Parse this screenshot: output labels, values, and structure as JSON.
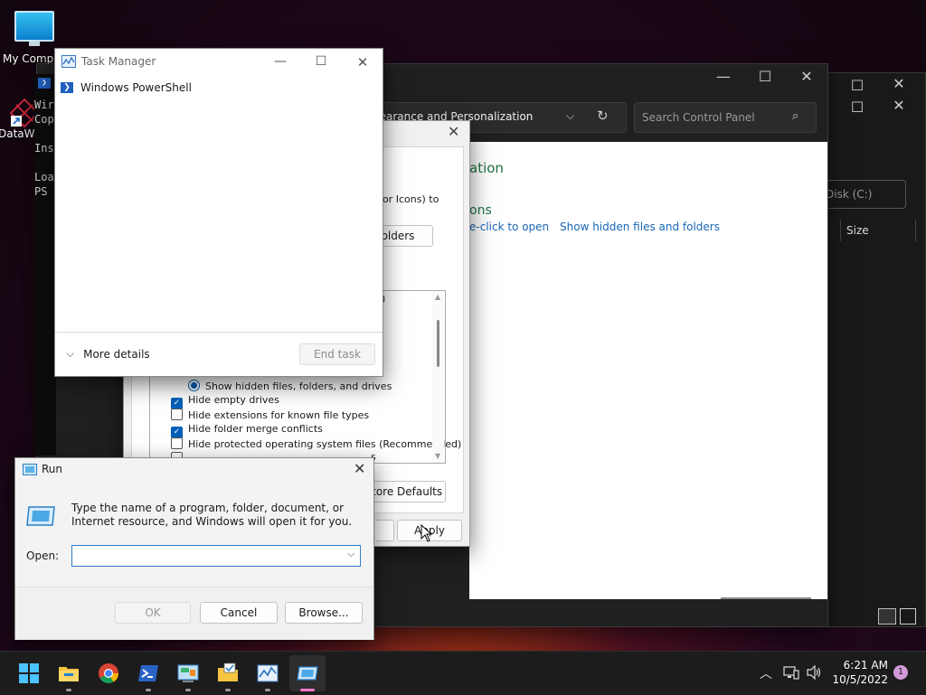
{
  "desktop": {
    "icons": [
      {
        "label": "My Computer"
      },
      {
        "label": "DataW"
      }
    ]
  },
  "powershell": {
    "lines": [
      "Wir",
      "Cop",
      "",
      "Ins",
      "",
      "Loa",
      "PS"
    ]
  },
  "control_panel": {
    "address": "nearance and Personalization",
    "search_placeholder": "Search Control Panel",
    "heading": "ation",
    "subheading": "ons",
    "link1": "e-click to open",
    "link2": "Show hidden files and folders"
  },
  "explorer_back": {
    "drive": "Disk (C:)",
    "col_size": "Size"
  },
  "folder_options": {
    "partial1": "or Icons) to",
    "partial_btn": "olders",
    "partial2": ")",
    "options": [
      {
        "label": "Show hidden files, folders, and drives",
        "type": "radio",
        "checked": true
      },
      {
        "label": "Hide empty drives",
        "type": "check",
        "checked": true
      },
      {
        "label": "Hide extensions for known file types",
        "type": "check",
        "checked": false
      },
      {
        "label": "Hide folder merge conflicts",
        "type": "check",
        "checked": true
      },
      {
        "label": "Hide protected operating system files (Recommended)",
        "type": "check",
        "checked": false
      }
    ],
    "partial_cut": "s",
    "restore_btn": "store Defaults",
    "apply_btn": "Apply"
  },
  "task_manager": {
    "title": "Task Manager",
    "process": "Windows PowerShell",
    "more_details": "More details",
    "end_task": "End task"
  },
  "run_dialog": {
    "title": "Run",
    "description": "Type the name of a program, folder, document, or Internet resource, and Windows will open it for you.",
    "open_label": "Open:",
    "open_value": "",
    "ok": "OK",
    "cancel": "Cancel",
    "browse": "Browse..."
  },
  "taskbar": {
    "time": "6:21 AM",
    "date": "10/5/2022",
    "notification_count": "1"
  },
  "colors": {
    "accent": "#005fb8",
    "link": "#1a66b5",
    "cp_green": "#1e7145",
    "taskbar": "#1c1c1c"
  }
}
